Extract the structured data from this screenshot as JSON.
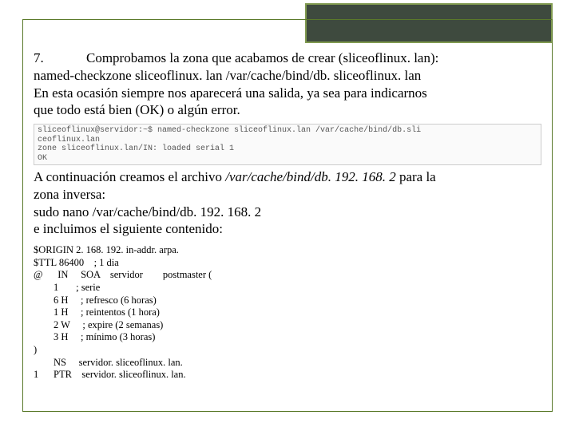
{
  "para1": {
    "number": "7.",
    "line1": "Comprobamos la zona que acabamos de crear (sliceoflinux. lan):",
    "line2": "named-checkzone sliceoflinux. lan /var/cache/bind/db. sliceoflinux. lan",
    "line3": "En esta ocasión siempre nos aparecerá una salida, ya sea para indicarnos",
    "line4": "que todo está bien (OK) o algún error."
  },
  "terminal": {
    "line1": "sliceoflinux@servidor:~$ named-checkzone sliceoflinux.lan /var/cache/bind/db.sli",
    "line2": "ceoflinux.lan",
    "line3": "zone sliceoflinux.lan/IN: loaded serial 1",
    "line4": "OK"
  },
  "para2": {
    "line1a": "A continuación creamos el archivo ",
    "line1b": "/var/cache/bind/db. 192. 168. 2",
    "line1c": " para la",
    "line2": "zona inversa:",
    "line3": "sudo nano /var/cache/bind/db. 192. 168. 2",
    "line4": "e incluimos el siguiente contenido:"
  },
  "config": "$ORIGIN 2. 168. 192. in-addr. arpa.\n$TTL 86400    ; 1 dia\n@      IN     SOA    servidor        postmaster (\n        1       ; serie\n        6 H     ; refresco (6 horas)\n        1 H     ; reintentos (1 hora)\n        2 W     ; expire (2 semanas)\n        3 H     ; mínimo (3 horas)\n)\n        NS     servidor. sliceoflinux. lan.\n1      PTR    servidor. sliceoflinux. lan."
}
